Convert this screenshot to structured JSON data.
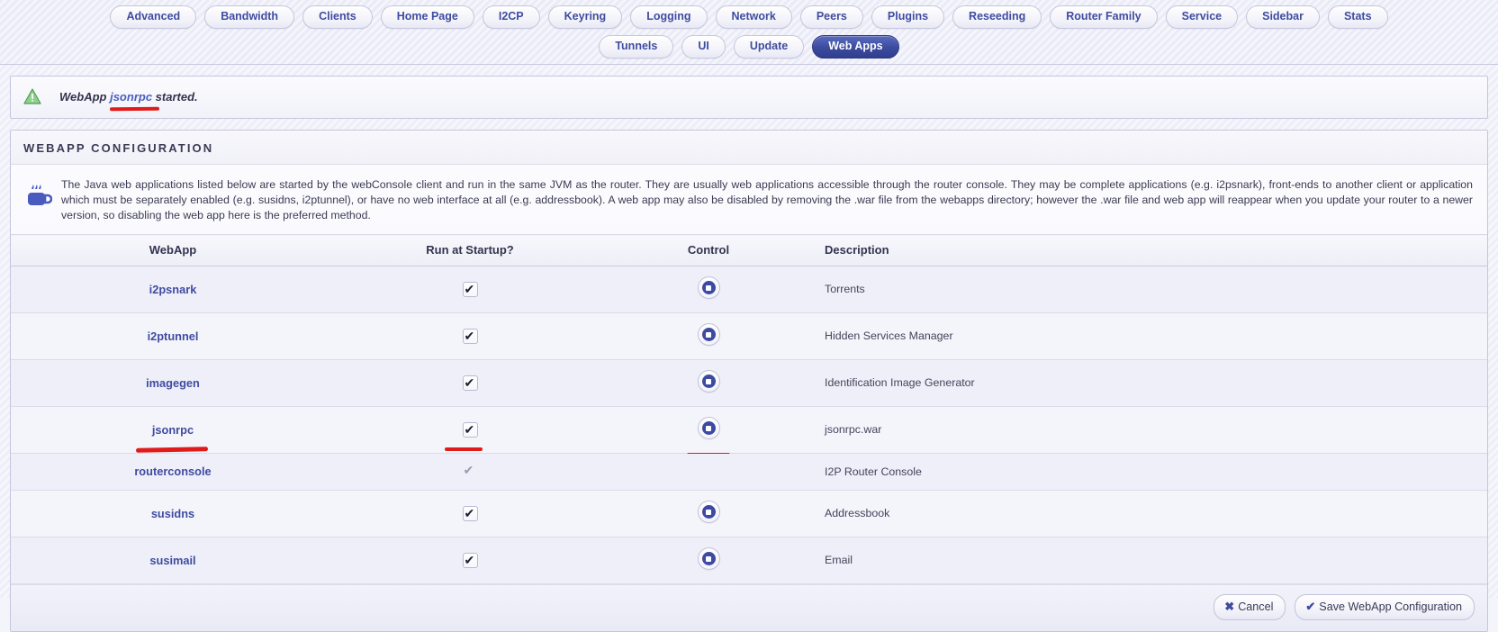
{
  "nav": {
    "row1": [
      {
        "label": "Advanced",
        "active": false
      },
      {
        "label": "Bandwidth",
        "active": false
      },
      {
        "label": "Clients",
        "active": false
      },
      {
        "label": "Home Page",
        "active": false
      },
      {
        "label": "I2CP",
        "active": false
      },
      {
        "label": "Keyring",
        "active": false
      },
      {
        "label": "Logging",
        "active": false
      },
      {
        "label": "Network",
        "active": false
      },
      {
        "label": "Peers",
        "active": false
      },
      {
        "label": "Plugins",
        "active": false
      },
      {
        "label": "Reseeding",
        "active": false
      },
      {
        "label": "Router Family",
        "active": false
      },
      {
        "label": "Service",
        "active": false
      },
      {
        "label": "Sidebar",
        "active": false
      },
      {
        "label": "Stats",
        "active": false
      }
    ],
    "row2": [
      {
        "label": "Tunnels",
        "active": false
      },
      {
        "label": "UI",
        "active": false
      },
      {
        "label": "Update",
        "active": false
      },
      {
        "label": "Web Apps",
        "active": true
      }
    ]
  },
  "notice": {
    "icon": "warning-triangle-icon",
    "prefix": "WebApp ",
    "app": "jsonrpc",
    "suffix": " started."
  },
  "panel": {
    "title": "WEBAPP CONFIGURATION",
    "icon": "java-coffee-cup-icon",
    "description": "The Java web applications listed below are started by the webConsole client and run in the same JVM as the router. They are usually web applications accessible through the router console. They may be complete applications (e.g. i2psnark), front-ends to another client or application which must be separately enabled (e.g. susidns, i2ptunnel), or have no web interface at all (e.g. addressbook).  A web app may also be disabled by removing the .war file from the webapps directory; however the .war file and web app will reappear when you update your router to a newer version, so disabling the web app here is the preferred method."
  },
  "table": {
    "headers": [
      "WebApp",
      "Run at Startup?",
      "Control",
      "Description"
    ],
    "rows": [
      {
        "app": "i2psnark",
        "linked": true,
        "checked": true,
        "disabled": false,
        "control": "stop-button",
        "desc": "Torrents",
        "annotated": false
      },
      {
        "app": "i2ptunnel",
        "linked": true,
        "checked": true,
        "disabled": false,
        "control": "stop-button",
        "desc": "Hidden Services Manager",
        "annotated": false
      },
      {
        "app": "imagegen",
        "linked": true,
        "checked": true,
        "disabled": false,
        "control": "stop-button",
        "desc": "Identification Image Generator",
        "annotated": false
      },
      {
        "app": "jsonrpc",
        "linked": true,
        "checked": true,
        "disabled": false,
        "control": "stop-button",
        "desc": "jsonrpc.war",
        "annotated": true
      },
      {
        "app": "routerconsole",
        "linked": false,
        "checked": true,
        "disabled": true,
        "control": "none",
        "desc": "I2P Router Console",
        "annotated": false
      },
      {
        "app": "susidns",
        "linked": true,
        "checked": true,
        "disabled": false,
        "control": "stop-button",
        "desc": "Addressbook",
        "annotated": false
      },
      {
        "app": "susimail",
        "linked": true,
        "checked": true,
        "disabled": false,
        "control": "stop-button",
        "desc": "Email",
        "annotated": false
      }
    ]
  },
  "footer": {
    "cancel_label": "Cancel",
    "cancel_icon": "cross-icon",
    "save_label": "Save WebApp Configuration",
    "save_icon": "check-icon"
  },
  "colors": {
    "accent": "#3f4ca0",
    "active_tab": "#3b4a9e",
    "annotation": "#e01b1b",
    "warning": "#62b462",
    "page_bg": "#f4f4fb"
  }
}
